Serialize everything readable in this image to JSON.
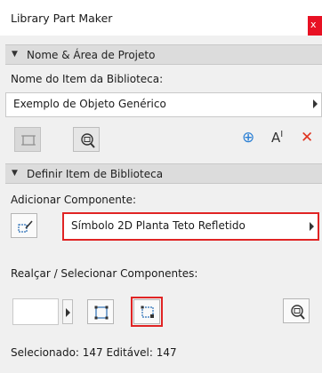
{
  "window": {
    "title": "Library Part Maker",
    "close_glyph": "x"
  },
  "section1": {
    "header": "Nome & Área de Projeto",
    "item_name_label": "Nome do Item da Biblioteca:",
    "item_name_value": "Exemplo de Objeto Genérico"
  },
  "toolbar1": {
    "icons": [
      "selection-rectangle-icon",
      "zoom-fit-icon",
      "add-circle-icon",
      "text-size-icon",
      "delete-x-icon"
    ],
    "text_size_glyph": "A",
    "text_size_cursor": "I",
    "delete_glyph": "✕",
    "add_glyph": "⊕",
    "accent_blue": "#2a7fd4",
    "delete_red": "#e0321e"
  },
  "section2": {
    "header": "Definir Item de Biblioteca",
    "add_component_label": "Adicionar Componente:",
    "component_value": "Símbolo 2D Planta Teto Refletido",
    "highlight_label": "Realçar / Selecionar Componentes:",
    "status": "Selecionado: 147 Editável: 147"
  },
  "colors": {
    "highlight_red": "#e02424",
    "section_bg": "#dcdcdc"
  }
}
